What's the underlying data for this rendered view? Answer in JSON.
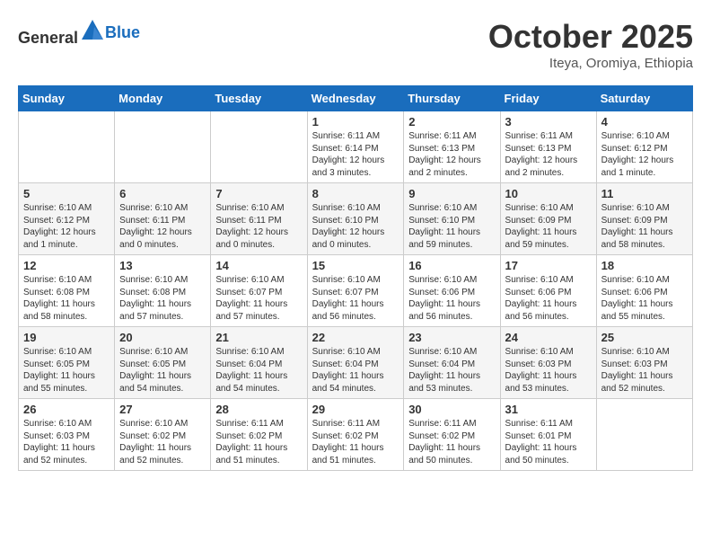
{
  "header": {
    "logo_general": "General",
    "logo_blue": "Blue",
    "month": "October 2025",
    "location": "Iteya, Oromiya, Ethiopia"
  },
  "weekdays": [
    "Sunday",
    "Monday",
    "Tuesday",
    "Wednesday",
    "Thursday",
    "Friday",
    "Saturday"
  ],
  "weeks": [
    [
      {
        "day": "",
        "info": ""
      },
      {
        "day": "",
        "info": ""
      },
      {
        "day": "",
        "info": ""
      },
      {
        "day": "1",
        "info": "Sunrise: 6:11 AM\nSunset: 6:14 PM\nDaylight: 12 hours and 3 minutes."
      },
      {
        "day": "2",
        "info": "Sunrise: 6:11 AM\nSunset: 6:13 PM\nDaylight: 12 hours and 2 minutes."
      },
      {
        "day": "3",
        "info": "Sunrise: 6:11 AM\nSunset: 6:13 PM\nDaylight: 12 hours and 2 minutes."
      },
      {
        "day": "4",
        "info": "Sunrise: 6:10 AM\nSunset: 6:12 PM\nDaylight: 12 hours and 1 minute."
      }
    ],
    [
      {
        "day": "5",
        "info": "Sunrise: 6:10 AM\nSunset: 6:12 PM\nDaylight: 12 hours and 1 minute."
      },
      {
        "day": "6",
        "info": "Sunrise: 6:10 AM\nSunset: 6:11 PM\nDaylight: 12 hours and 0 minutes."
      },
      {
        "day": "7",
        "info": "Sunrise: 6:10 AM\nSunset: 6:11 PM\nDaylight: 12 hours and 0 minutes."
      },
      {
        "day": "8",
        "info": "Sunrise: 6:10 AM\nSunset: 6:10 PM\nDaylight: 12 hours and 0 minutes."
      },
      {
        "day": "9",
        "info": "Sunrise: 6:10 AM\nSunset: 6:10 PM\nDaylight: 11 hours and 59 minutes."
      },
      {
        "day": "10",
        "info": "Sunrise: 6:10 AM\nSunset: 6:09 PM\nDaylight: 11 hours and 59 minutes."
      },
      {
        "day": "11",
        "info": "Sunrise: 6:10 AM\nSunset: 6:09 PM\nDaylight: 11 hours and 58 minutes."
      }
    ],
    [
      {
        "day": "12",
        "info": "Sunrise: 6:10 AM\nSunset: 6:08 PM\nDaylight: 11 hours and 58 minutes."
      },
      {
        "day": "13",
        "info": "Sunrise: 6:10 AM\nSunset: 6:08 PM\nDaylight: 11 hours and 57 minutes."
      },
      {
        "day": "14",
        "info": "Sunrise: 6:10 AM\nSunset: 6:07 PM\nDaylight: 11 hours and 57 minutes."
      },
      {
        "day": "15",
        "info": "Sunrise: 6:10 AM\nSunset: 6:07 PM\nDaylight: 11 hours and 56 minutes."
      },
      {
        "day": "16",
        "info": "Sunrise: 6:10 AM\nSunset: 6:06 PM\nDaylight: 11 hours and 56 minutes."
      },
      {
        "day": "17",
        "info": "Sunrise: 6:10 AM\nSunset: 6:06 PM\nDaylight: 11 hours and 56 minutes."
      },
      {
        "day": "18",
        "info": "Sunrise: 6:10 AM\nSunset: 6:06 PM\nDaylight: 11 hours and 55 minutes."
      }
    ],
    [
      {
        "day": "19",
        "info": "Sunrise: 6:10 AM\nSunset: 6:05 PM\nDaylight: 11 hours and 55 minutes."
      },
      {
        "day": "20",
        "info": "Sunrise: 6:10 AM\nSunset: 6:05 PM\nDaylight: 11 hours and 54 minutes."
      },
      {
        "day": "21",
        "info": "Sunrise: 6:10 AM\nSunset: 6:04 PM\nDaylight: 11 hours and 54 minutes."
      },
      {
        "day": "22",
        "info": "Sunrise: 6:10 AM\nSunset: 6:04 PM\nDaylight: 11 hours and 54 minutes."
      },
      {
        "day": "23",
        "info": "Sunrise: 6:10 AM\nSunset: 6:04 PM\nDaylight: 11 hours and 53 minutes."
      },
      {
        "day": "24",
        "info": "Sunrise: 6:10 AM\nSunset: 6:03 PM\nDaylight: 11 hours and 53 minutes."
      },
      {
        "day": "25",
        "info": "Sunrise: 6:10 AM\nSunset: 6:03 PM\nDaylight: 11 hours and 52 minutes."
      }
    ],
    [
      {
        "day": "26",
        "info": "Sunrise: 6:10 AM\nSunset: 6:03 PM\nDaylight: 11 hours and 52 minutes."
      },
      {
        "day": "27",
        "info": "Sunrise: 6:10 AM\nSunset: 6:02 PM\nDaylight: 11 hours and 52 minutes."
      },
      {
        "day": "28",
        "info": "Sunrise: 6:11 AM\nSunset: 6:02 PM\nDaylight: 11 hours and 51 minutes."
      },
      {
        "day": "29",
        "info": "Sunrise: 6:11 AM\nSunset: 6:02 PM\nDaylight: 11 hours and 51 minutes."
      },
      {
        "day": "30",
        "info": "Sunrise: 6:11 AM\nSunset: 6:02 PM\nDaylight: 11 hours and 50 minutes."
      },
      {
        "day": "31",
        "info": "Sunrise: 6:11 AM\nSunset: 6:01 PM\nDaylight: 11 hours and 50 minutes."
      },
      {
        "day": "",
        "info": ""
      }
    ]
  ]
}
